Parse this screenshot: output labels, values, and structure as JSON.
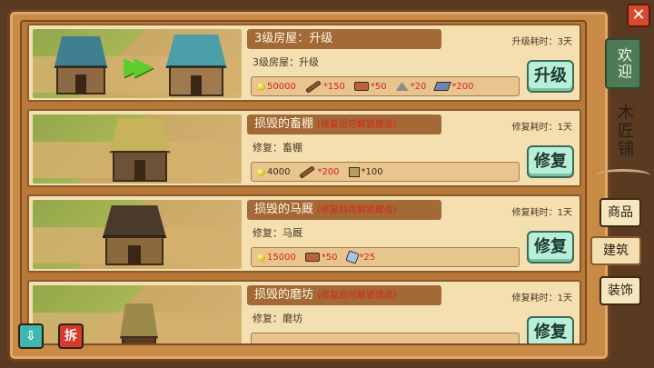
{
  "close_label": "✕",
  "cards": [
    {
      "title": "3级房屋：升级",
      "hint": "",
      "time": "升级耗时：3天",
      "desc": "3级房屋：升级",
      "button": "升级",
      "costs": [
        {
          "icon": "coin",
          "amount": "50000",
          "red": true
        },
        {
          "icon": "wood",
          "amount": "*150",
          "red": true
        },
        {
          "icon": "plank",
          "amount": "*50",
          "red": true
        },
        {
          "icon": "stone",
          "amount": "*20",
          "red": true
        },
        {
          "icon": "iron",
          "amount": "*200",
          "red": true
        }
      ]
    },
    {
      "title": "损毁的畜棚",
      "hint": "(修复后可解锁建造)",
      "time": "修复耗时：1天",
      "desc": "修复：畜棚",
      "button": "修复",
      "costs": [
        {
          "icon": "coin",
          "amount": "4000",
          "red": false
        },
        {
          "icon": "wood",
          "amount": "*200",
          "red": true
        },
        {
          "icon": "hay",
          "amount": "*100",
          "red": false
        }
      ]
    },
    {
      "title": "损毁的马厩",
      "hint": "(修复后可解锁建造)",
      "time": "修复耗时：1天",
      "desc": "修复：马厩",
      "button": "修复",
      "costs": [
        {
          "icon": "coin",
          "amount": "15000",
          "red": true
        },
        {
          "icon": "plank",
          "amount": "*50",
          "red": true
        },
        {
          "icon": "tile",
          "amount": "*25",
          "red": true
        }
      ]
    },
    {
      "title": "损毁的磨坊",
      "hint": "(修复后可解锁建造)",
      "time": "修复耗时：1天",
      "desc": "修复：磨坊",
      "button": "修复",
      "costs": []
    }
  ],
  "side": {
    "welcome_tab": "欢迎",
    "shop_name": "木匠铺",
    "tabs": [
      "商品",
      "建筑",
      "装饰"
    ]
  },
  "bottom_buttons": {
    "demolish_label": "拆"
  },
  "colors": {
    "accent_green": "#b8efd9",
    "cost_red": "#d8241c",
    "frame_brown": "#c98a46"
  }
}
